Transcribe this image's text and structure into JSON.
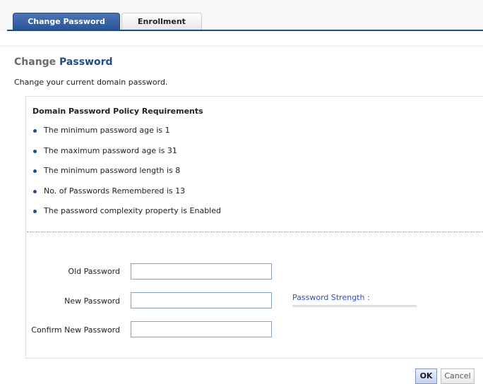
{
  "tabs": [
    {
      "label": "Change Password",
      "active": true
    },
    {
      "label": "Enrollment",
      "active": false
    }
  ],
  "header": {
    "title_part1": "Change",
    "title_part2": "Password",
    "description": "Change your current domain password."
  },
  "policy": {
    "heading": "Domain Password Policy Requirements",
    "items": [
      "The minimum password age is 1",
      "The maximum password age is 31",
      "The minimum password length is 8",
      "No. of Passwords Remembered is 13",
      "The password complexity property is Enabled"
    ]
  },
  "form": {
    "old_password": {
      "label": "Old Password",
      "value": ""
    },
    "new_password": {
      "label": "New Password",
      "value": ""
    },
    "confirm_password": {
      "label": "Confirm New Password",
      "value": ""
    },
    "strength": {
      "label": "Password Strength :",
      "level": 0
    }
  },
  "buttons": {
    "ok": "OK",
    "cancel": "Cancel"
  },
  "colors": {
    "accent": "#1f4e8c",
    "strength_label": "#2c4fc9"
  }
}
